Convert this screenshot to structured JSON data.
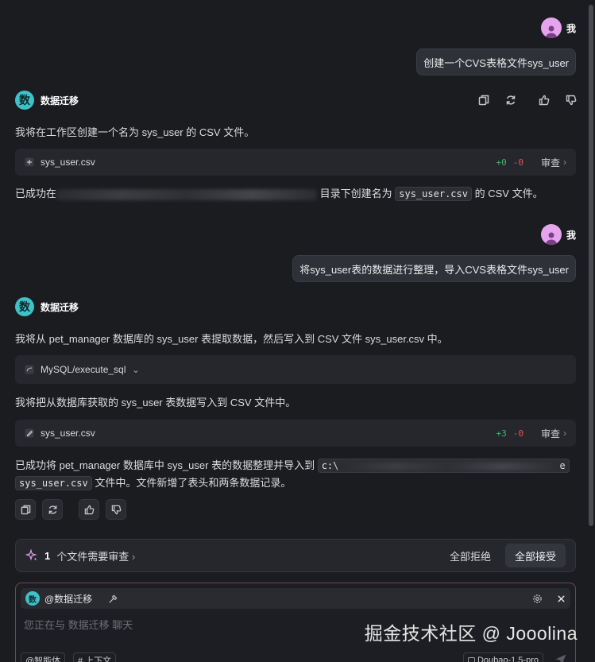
{
  "user": {
    "name": "我"
  },
  "bot": {
    "name": "数据迁移",
    "avatar_char": "数"
  },
  "messages": {
    "m1_user": "创建一个CVS表格文件sys_user",
    "m2_intro": "我将在工作区创建一个名为 sys_user 的 CSV 文件。",
    "m2_file": {
      "name": "sys_user.csv",
      "added": "+0",
      "removed": "-0",
      "review": "审查"
    },
    "m2_result": {
      "prefix": "已成功在",
      "middle": "目录下创建名为",
      "code": "sys_user.csv",
      "suffix": "的 CSV 文件。"
    },
    "m3_user": "将sys_user表的数据进行整理，导入CVS表格文件sys_user",
    "m4_intro": "我将从 pet_manager 数据库的 sys_user 表提取数据，然后写入到 CSV 文件 sys_user.csv 中。",
    "m4_tool": "MySQL/execute_sql",
    "m4_mid": "我将把从数据库获取的 sys_user 表数据写入到 CSV 文件中。",
    "m4_file": {
      "name": "sys_user.csv",
      "added": "+3",
      "removed": "-0",
      "review": "审查"
    },
    "m4_result": {
      "prefix": "已成功将 pet_manager 数据库中 sys_user 表的数据整理并导入到",
      "path_start": "c:\\",
      "path_end": "e",
      "code": "sys_user.csv",
      "suffix": "文件中。文件新增了表头和两条数据记录。"
    }
  },
  "review_bar": {
    "count": "1",
    "label": "个文件需要审查",
    "reject_all": "全部拒绝",
    "accept_all": "全部接受"
  },
  "composer": {
    "agent": "@数据迁移",
    "placeholder": "您正在与 数据迁移 聊天",
    "chip_agent": "@智能体",
    "chip_context": "# 上下文",
    "model": "Doubao-1.5-pro"
  },
  "watermark": "掘金技术社区 @ Jooolina",
  "colors": {
    "background": "#1b1c20",
    "accent_bot": "#3fc1c9",
    "user_avatar": "#e6a4ef",
    "added": "#3fb36b",
    "removed": "#e0525a"
  }
}
